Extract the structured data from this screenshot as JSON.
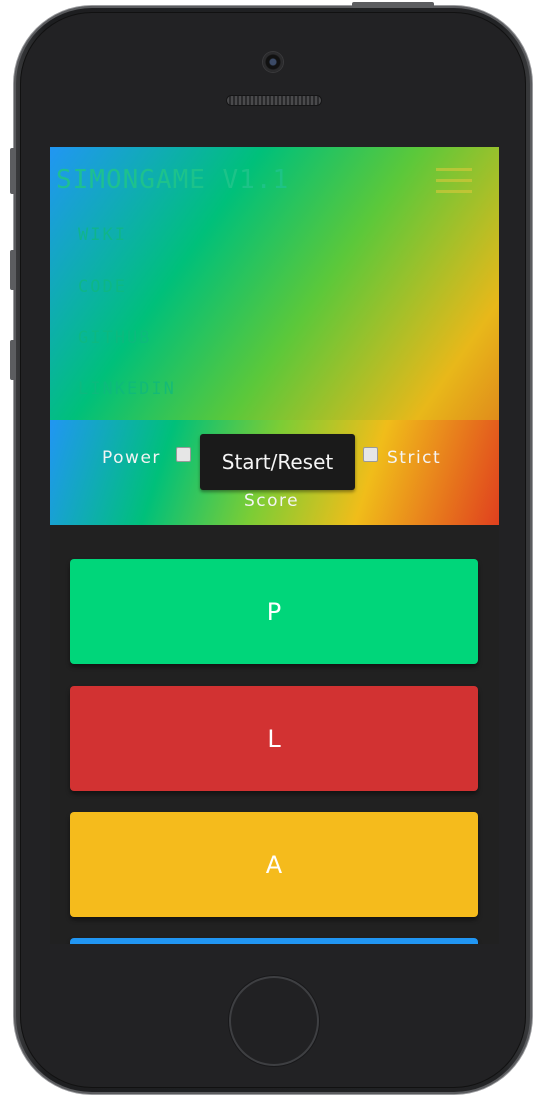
{
  "app": {
    "title": "SIMONGAME V1.1"
  },
  "nav": {
    "items": [
      "WIKI",
      "CODE",
      "GITHUB",
      "LINKEDIN"
    ]
  },
  "controls": {
    "power_label": "Power",
    "power_checked": false,
    "start_label": "Start/Reset",
    "strict_label": "Strict",
    "strict_checked": false,
    "score_label": "Score"
  },
  "pads": [
    {
      "label": "P",
      "color": "#00d67a"
    },
    {
      "label": "L",
      "color": "#d23232"
    },
    {
      "label": "A",
      "color": "#f5bb1c"
    },
    {
      "label": "",
      "color": "#2196f3"
    }
  ],
  "colors": {
    "gradient_blue": "#2196f3",
    "gradient_green": "#00c07a",
    "gradient_yellow": "#f0bd1a",
    "gradient_red": "#e0401e",
    "screen_bg": "#212121"
  },
  "icons": {
    "menu": "hamburger-icon"
  }
}
